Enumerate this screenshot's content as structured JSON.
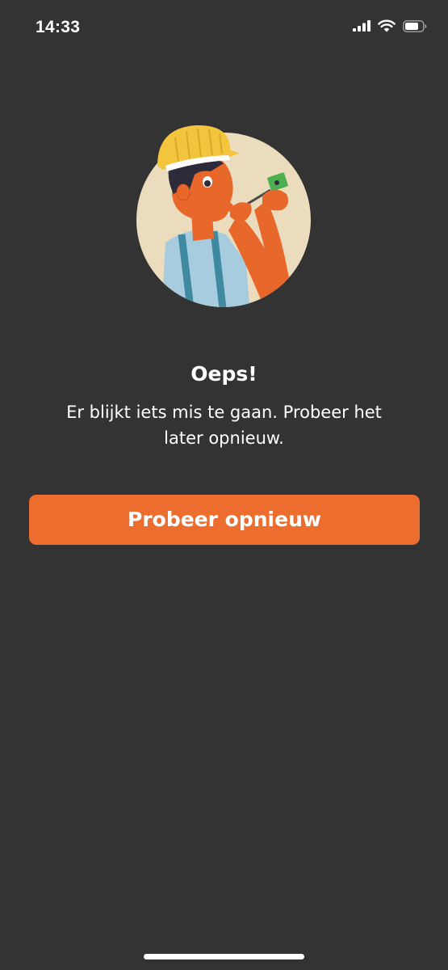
{
  "status_bar": {
    "time": "14:33",
    "icons": [
      "cellular-signal-icon",
      "wifi-icon",
      "battery-icon"
    ]
  },
  "illustration": {
    "subject": "construction-worker-repairing-chip-illustration"
  },
  "error": {
    "title": "Oeps!",
    "message": "Er blijkt iets mis te gaan. Probeer het later opnieuw."
  },
  "actions": {
    "retry_label": "Probeer opnieuw"
  },
  "colors": {
    "background": "#333333",
    "accent": "#ec6d2e",
    "text": "#ffffff",
    "illustration_circle": "#ecdcbe",
    "helmet": "#f2c53d",
    "skin": "#e8682c"
  }
}
